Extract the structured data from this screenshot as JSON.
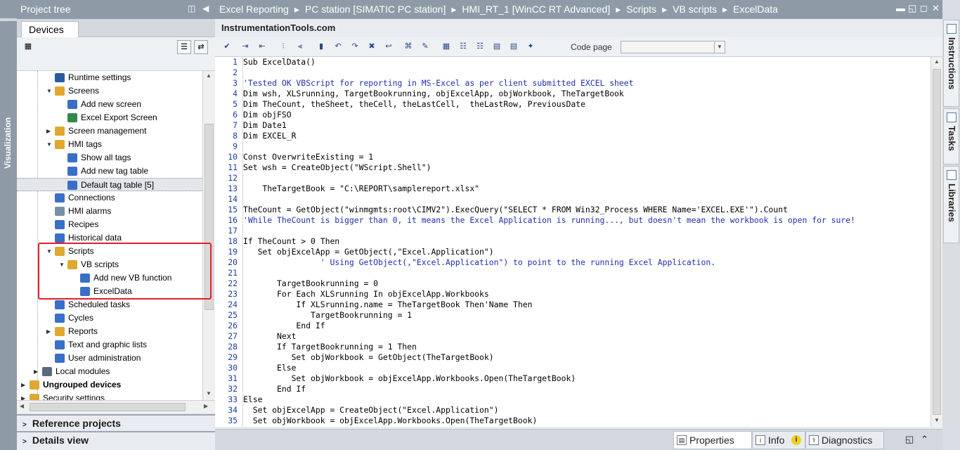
{
  "left_strip": {
    "label": "Visualization"
  },
  "project_tree": {
    "title": "Project tree",
    "tab": "Devices",
    "items": [
      {
        "label": "Runtime settings",
        "indent": 2,
        "arrow": "",
        "color": "#2c5aa0"
      },
      {
        "label": "Screens",
        "indent": 2,
        "arrow": "▼",
        "color": "#e0a830"
      },
      {
        "label": "Add new screen",
        "indent": 3,
        "arrow": "",
        "color": "#3a6fc8"
      },
      {
        "label": "Excel Export Screen",
        "indent": 3,
        "arrow": "",
        "color": "#2f8a4a"
      },
      {
        "label": "Screen management",
        "indent": 2,
        "arrow": "▶",
        "color": "#e0a830"
      },
      {
        "label": "HMI tags",
        "indent": 2,
        "arrow": "▼",
        "color": "#e0a830"
      },
      {
        "label": "Show all tags",
        "indent": 3,
        "arrow": "",
        "color": "#3a6fc8"
      },
      {
        "label": "Add new tag table",
        "indent": 3,
        "arrow": "",
        "color": "#3a6fc8"
      },
      {
        "label": "Default tag table [5]",
        "indent": 3,
        "arrow": "",
        "color": "#3a6fc8",
        "selected": true
      },
      {
        "label": "Connections",
        "indent": 2,
        "arrow": "",
        "color": "#3a6fc8"
      },
      {
        "label": "HMI alarms",
        "indent": 2,
        "arrow": "",
        "color": "#7a8ea8"
      },
      {
        "label": "Recipes",
        "indent": 2,
        "arrow": "",
        "color": "#3a6fc8"
      },
      {
        "label": "Historical data",
        "indent": 2,
        "arrow": "",
        "color": "#3a6fc8"
      },
      {
        "label": "Scripts",
        "indent": 2,
        "arrow": "▼",
        "color": "#e0a830"
      },
      {
        "label": "VB scripts",
        "indent": 3,
        "arrow": "▼",
        "color": "#e0a830"
      },
      {
        "label": "Add new VB function",
        "indent": 4,
        "arrow": "",
        "color": "#3a6fc8"
      },
      {
        "label": "ExcelData",
        "indent": 4,
        "arrow": "",
        "color": "#3a6fc8"
      },
      {
        "label": "Scheduled tasks",
        "indent": 2,
        "arrow": "",
        "color": "#3a6fc8"
      },
      {
        "label": "Cycles",
        "indent": 2,
        "arrow": "",
        "color": "#3a6fc8"
      },
      {
        "label": "Reports",
        "indent": 2,
        "arrow": "▶",
        "color": "#e0a830"
      },
      {
        "label": "Text and graphic lists",
        "indent": 2,
        "arrow": "",
        "color": "#3a6fc8"
      },
      {
        "label": "User administration",
        "indent": 2,
        "arrow": "",
        "color": "#3a6fc8"
      },
      {
        "label": "Local modules",
        "indent": 1,
        "arrow": "▶",
        "color": "#5a6a7a"
      },
      {
        "label": "Ungrouped devices",
        "indent": 0,
        "arrow": "▶",
        "color": "#e0a830",
        "bold": true
      },
      {
        "label": "Security settings",
        "indent": 0,
        "arrow": "▶",
        "color": "#e0a830"
      }
    ],
    "sections": {
      "reference": "Reference projects",
      "details": "Details view"
    }
  },
  "editor": {
    "breadcrumb": [
      "Excel Reporting",
      "PC station [SIMATIC PC station]",
      "HMI_RT_1 [WinCC RT Advanced]",
      "Scripts",
      "VB scripts",
      "ExcelData"
    ],
    "breadcrumb_sep": "▸",
    "subtitle": "InstrumentationTools.com",
    "code_page_label": "Code page",
    "lines": [
      "Sub ExcelData()",
      "",
      "'Tested OK VBScript for reporting in MS-Excel as per client submitted EXCEL sheet",
      "Dim wsh, XLSrunning, TargetBookrunning, objExcelApp, objWorkbook, TheTargetBook",
      "Dim TheCount, theSheet, theCell, theLastCell,  theLastRow, PreviousDate",
      "Dim objFSO",
      "Dim Date1",
      "Dim EXCEL_R",
      "",
      "Const OverwriteExisting = 1",
      "Set wsh = CreateObject(\"WScript.Shell\")",
      "",
      "    TheTargetBook = \"C:\\REPORT\\samplereport.xlsx\"",
      "",
      "TheCount = GetObject(\"winmgmts:root\\CIMV2\").ExecQuery(\"SELECT * FROM Win32_Process WHERE Name='EXCEL.EXE'\").Count",
      "'While TheCount is bigger than 0, it means the Excel Application is running..., but doesn't mean the workbook is open for sure!",
      "",
      "If TheCount > 0 Then",
      "   Set objExcelApp = GetObject(,\"Excel.Application\")",
      "                ' Using GetObject(,\"Excel.Application\") to point to the running Excel Application.",
      "",
      "       TargetBookrunning = 0",
      "       For Each XLSrunning In objExcelApp.Workbooks",
      "           If XLSrunning.name = TheTargetBook Then'Name Then",
      "              TargetBookrunning = 1",
      "           End If",
      "       Next",
      "       If TargetBookrunning = 1 Then",
      "          Set objWorkbook = GetObject(TheTargetBook)",
      "       Else",
      "          Set objWorkbook = objExcelApp.Workbooks.Open(TheTargetBook)",
      "       End If",
      "Else",
      "  Set objExcelApp = CreateObject(\"Excel.Application\")",
      "  Set objWorkbook = objExcelApp.Workbooks.Open(TheTargetBook)"
    ]
  },
  "bottom_tabs": [
    "Properties",
    "Info",
    "Diagnostics"
  ],
  "right_tabs": [
    "Instructions",
    "Tasks",
    "Libraries"
  ],
  "colors": {
    "keyword": "#1f2fb0",
    "string": "#1f2fb0",
    "comment": "#1f2fb0",
    "identifier": "#7a2d8c",
    "highlight": "#e0202a"
  }
}
